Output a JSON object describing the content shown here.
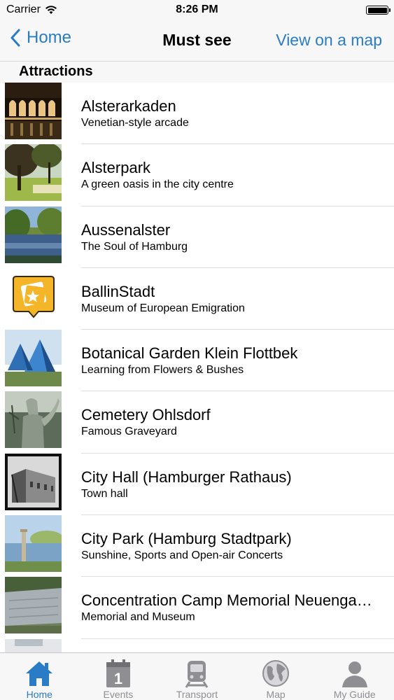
{
  "status": {
    "carrier": "Carrier",
    "time": "8:26 PM"
  },
  "nav": {
    "back_label": "Home",
    "title": "Must see",
    "right_label": "View on a map"
  },
  "section": {
    "title": "Attractions"
  },
  "items": [
    {
      "title": "Alsterarkaden",
      "subtitle": "Venetian-style arcade"
    },
    {
      "title": "Alsterpark",
      "subtitle": "A green oasis in the city centre"
    },
    {
      "title": "Aussenalster",
      "subtitle": "The Soul of Hamburg"
    },
    {
      "title": "BallinStadt",
      "subtitle": "Museum of European Emigration"
    },
    {
      "title": "Botanical Garden Klein Flottbek",
      "subtitle": "Learning from Flowers & Bushes"
    },
    {
      "title": "Cemetery Ohlsdorf",
      "subtitle": "Famous Graveyard"
    },
    {
      "title": "City Hall (Hamburger Rathaus)",
      "subtitle": "Town hall"
    },
    {
      "title": "City Park (Hamburg Stadtpark)",
      "subtitle": "Sunshine, Sports and Open-air Concerts"
    },
    {
      "title": "Concentration Camp Memorial Neuengamme",
      "subtitle": "Memorial and Museum"
    },
    {
      "title": "",
      "subtitle": ""
    }
  ],
  "tabs": [
    {
      "label": "Home",
      "icon": "home-icon",
      "active": true
    },
    {
      "label": "Events",
      "icon": "calendar-icon",
      "active": false
    },
    {
      "label": "Transport",
      "icon": "train-icon",
      "active": false
    },
    {
      "label": "Map",
      "icon": "globe-icon",
      "active": false
    },
    {
      "label": "My Guide",
      "icon": "person-icon",
      "active": false
    }
  ],
  "colors": {
    "accent": "#2a7cc7",
    "inactive": "#8e8e93",
    "bar": "#f7f7f8"
  }
}
